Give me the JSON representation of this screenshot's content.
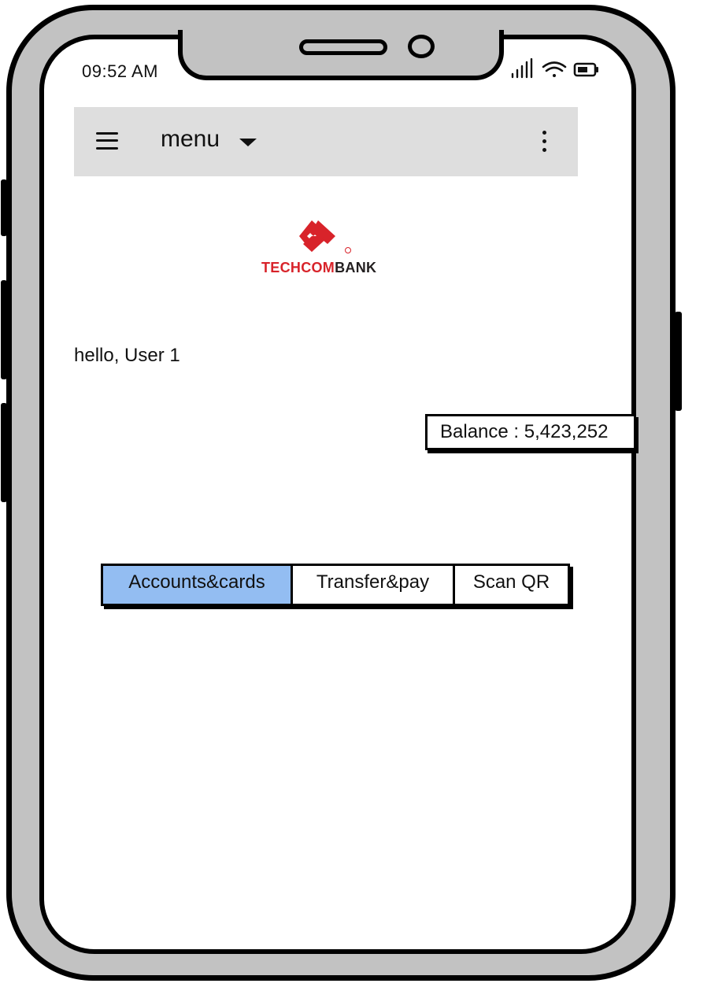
{
  "status_bar": {
    "time": "09:52 AM",
    "icons": [
      "signal-icon",
      "wifi-icon",
      "battery-icon"
    ]
  },
  "app_bar": {
    "menu_label": "menu",
    "icons": [
      "hamburger-icon",
      "dropdown-caret-icon",
      "more-vert-icon"
    ],
    "background": "#dedede"
  },
  "logo": {
    "brand_red": "TECHCOM",
    "brand_dark": "BANK",
    "mark_color": "#d8232a"
  },
  "greeting": "hello, User 1",
  "balance": "Balance : 5,423,252",
  "tabs": [
    {
      "label": "Accounts&cards",
      "active": true
    },
    {
      "label": "Transfer&pay",
      "active": false
    },
    {
      "label": "Scan QR",
      "active": false
    }
  ],
  "colors": {
    "active_tab": "#93bdf2",
    "frame": "#c2c2c2"
  }
}
